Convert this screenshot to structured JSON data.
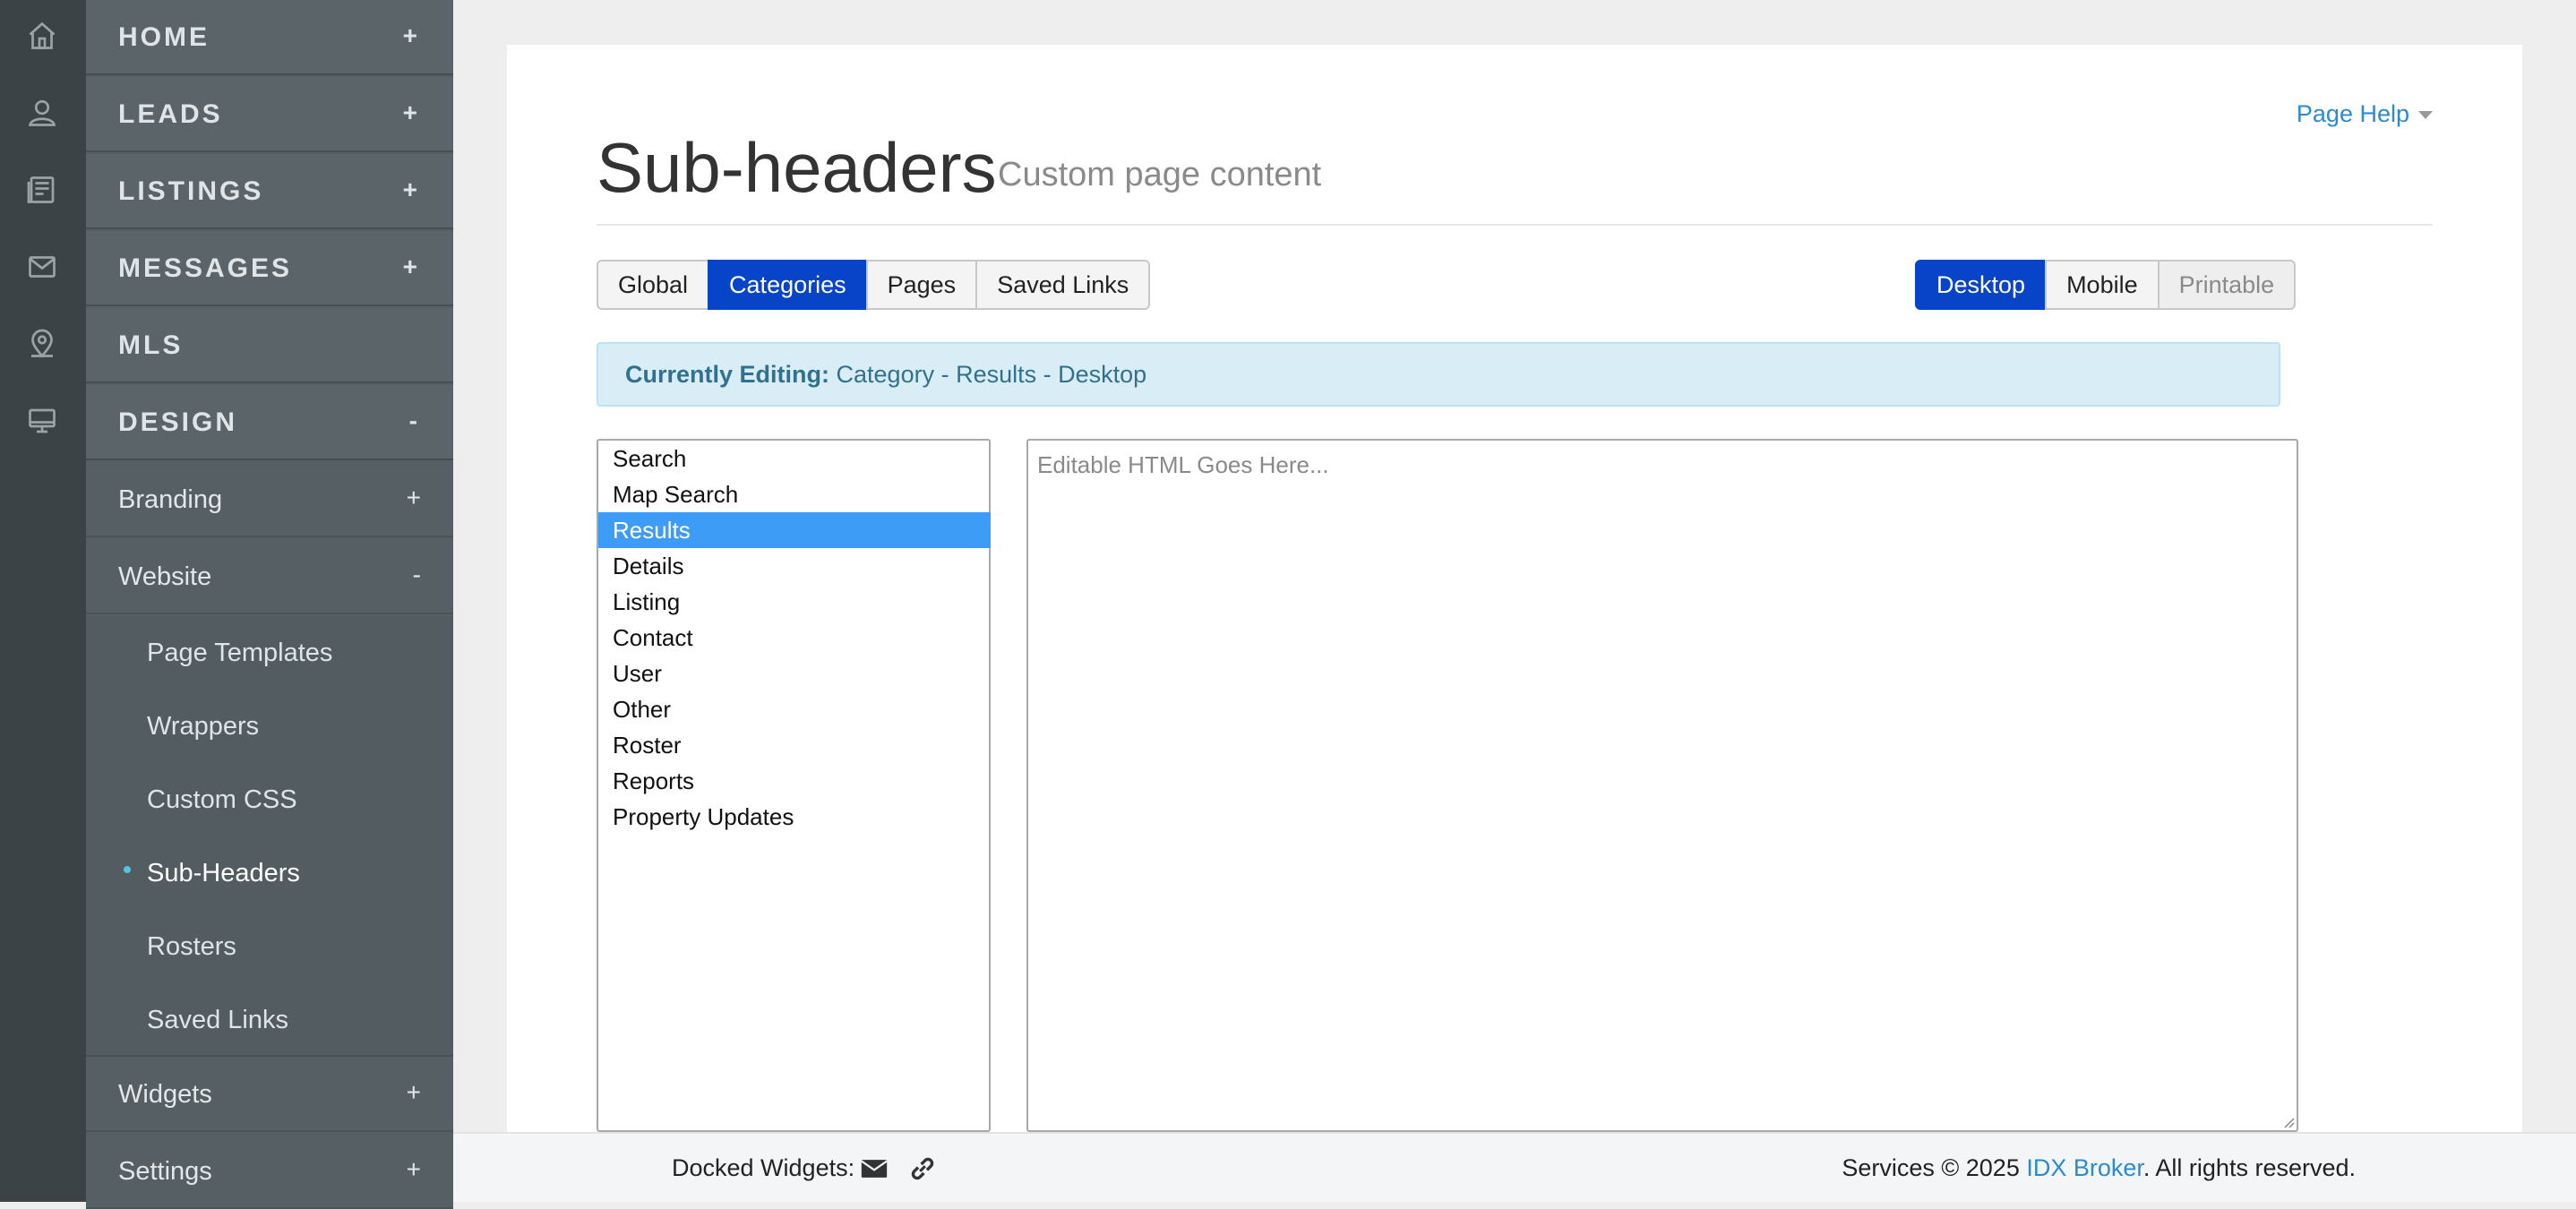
{
  "sidebar": {
    "top_items": [
      {
        "label": "HOME",
        "sign": "+"
      },
      {
        "label": "LEADS",
        "sign": "+"
      },
      {
        "label": "LISTINGS",
        "sign": "+"
      },
      {
        "label": "MESSAGES",
        "sign": "+"
      },
      {
        "label": "MLS",
        "sign": ""
      },
      {
        "label": "DESIGN",
        "sign": "-"
      }
    ],
    "design_items": [
      {
        "label": "Branding",
        "sign": "+"
      },
      {
        "label": "Website",
        "sign": "-"
      }
    ],
    "website_items": [
      {
        "label": "Page Templates"
      },
      {
        "label": "Wrappers"
      },
      {
        "label": "Custom CSS"
      },
      {
        "label": "Sub-Headers"
      },
      {
        "label": "Rosters"
      },
      {
        "label": "Saved Links"
      }
    ],
    "bottom_items": [
      {
        "label": "Widgets",
        "sign": "+"
      },
      {
        "label": "Settings",
        "sign": "+"
      }
    ]
  },
  "header": {
    "title": "Sub-headers",
    "subtitle": "Custom page content",
    "page_help": "Page Help"
  },
  "tabs": [
    "Global",
    "Categories",
    "Pages",
    "Saved Links"
  ],
  "active_tab": "Categories",
  "device_tabs": [
    "Desktop",
    "Mobile",
    "Printable"
  ],
  "active_device": "Desktop",
  "alert": {
    "label": "Currently Editing:",
    "value": "Category - Results - Desktop"
  },
  "categories": [
    "Search",
    "Map Search",
    "Results",
    "Details",
    "Listing",
    "Contact",
    "User",
    "Other",
    "Roster",
    "Reports",
    "Property Updates"
  ],
  "selected_category": "Results",
  "editor": {
    "placeholder": "Editable HTML Goes Here..."
  },
  "footer": {
    "docked_label": "Docked Widgets:",
    "copyright_prefix": "Services © 2025",
    "brand": "IDX Broker",
    "copyright_suffix": ". All rights reserved."
  },
  "colors": {
    "accent": "#0844c8",
    "selected": "#3d9cf5",
    "link": "#2a8bd1",
    "sidebar": "#566064",
    "rail": "#3b4347"
  }
}
